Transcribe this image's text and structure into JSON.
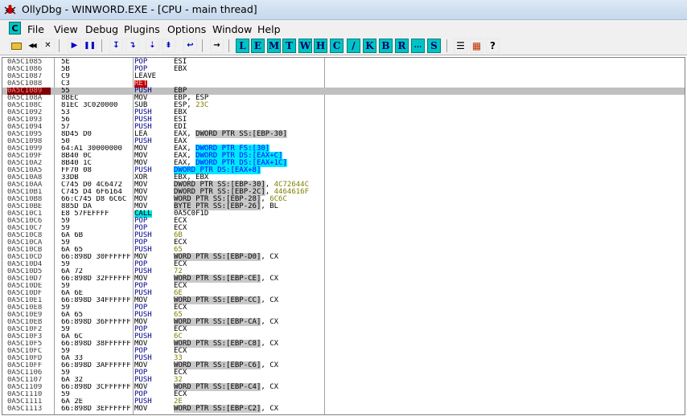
{
  "window": {
    "title": "OllyDbg - WINWORD.EXE - [CPU - main thread]"
  },
  "menu": {
    "cpu_button": "C",
    "items": [
      "File",
      "View",
      "Debug",
      "Plugins",
      "Options",
      "Window",
      "Help"
    ]
  },
  "toolbar": {
    "buttons": [
      {
        "name": "open-icon",
        "glyph": "▭"
      },
      {
        "name": "restart-icon",
        "glyph": "◀◀"
      },
      {
        "name": "close-icon",
        "glyph": "✕"
      },
      {
        "name": "run-icon",
        "glyph": "▶"
      },
      {
        "name": "pause-icon",
        "glyph": "❚❚"
      },
      {
        "name": "step-into-icon",
        "glyph": "↧"
      },
      {
        "name": "step-over-icon",
        "glyph": "↴"
      },
      {
        "name": "trace-into-icon",
        "glyph": "⇣"
      },
      {
        "name": "trace-over-icon",
        "glyph": "⇟"
      },
      {
        "name": "execute-till-return-icon",
        "glyph": "↩"
      },
      {
        "name": "go-to-icon",
        "glyph": "→"
      }
    ],
    "letters": [
      "L",
      "E",
      "M",
      "T",
      "W",
      "H",
      "C",
      "/",
      "K",
      "B",
      "R",
      "...",
      "S"
    ],
    "extra": [
      {
        "name": "list-icon",
        "glyph": "☰"
      },
      {
        "name": "grid-icon",
        "glyph": "▦"
      },
      {
        "name": "help-icon",
        "glyph": "?"
      }
    ]
  },
  "colors": {
    "jump_highlight": "#00e8ff",
    "eip_row": "#c0c0c0",
    "ret_bg": "#c00000",
    "call_bg": "#00e0e0"
  },
  "disasm": [
    {
      "addr": "0A5C1085",
      "hex": "5E",
      "mn": "POP",
      "op": "ESI"
    },
    {
      "addr": "0A5C1086",
      "hex": "5B",
      "mn": "POP",
      "op": "EBX"
    },
    {
      "addr": "0A5C1087",
      "hex": "C9",
      "mn": "LEAVE",
      "op": ""
    },
    {
      "addr": "0A5C1088",
      "hex": "C3",
      "mn": "RET",
      "op": ""
    },
    {
      "addr": "0A5C1089",
      "hex": "55",
      "mn": "PUSH",
      "op": "EBP"
    },
    {
      "addr": "0A5C108A",
      "hex": "8BEC",
      "mn": "MOV",
      "op": "EBP, ESP"
    },
    {
      "addr": "0A5C108C",
      "hex": "81EC 3C020000",
      "mn": "SUB",
      "op": "ESP, ",
      "tail": "23C"
    },
    {
      "addr": "0A5C1092",
      "hex": "53",
      "mn": "PUSH",
      "op": "EBX"
    },
    {
      "addr": "0A5C1093",
      "hex": "56",
      "mn": "PUSH",
      "op": "ESI"
    },
    {
      "addr": "0A5C1094",
      "hex": "57",
      "mn": "PUSH",
      "op": "EDI"
    },
    {
      "addr": "0A5C1095",
      "hex": "8D45 D0",
      "mn": "LEA",
      "op": "EAX, ",
      "mem": "DWORD PTR SS:[EBP-30]"
    },
    {
      "addr": "0A5C1098",
      "hex": "50",
      "mn": "PUSH",
      "op": "EAX"
    },
    {
      "addr": "0A5C1099",
      "hex": "64:A1 30000000",
      "mn": "MOV",
      "op": "EAX, ",
      "hi": "DWORD PTR FS:[30]"
    },
    {
      "addr": "0A5C109F",
      "hex": "8B40 0C",
      "mn": "MOV",
      "op": "EAX, ",
      "hi": "DWORD PTR DS:[EAX+C]"
    },
    {
      "addr": "0A5C10A2",
      "hex": "8B40 1C",
      "mn": "MOV",
      "op": "EAX, ",
      "hi": "DWORD PTR DS:[EAX+1C]"
    },
    {
      "addr": "0A5C10A5",
      "hex": "FF70 08",
      "mn": "PUSH",
      "op": "",
      "hi": "DWORD PTR DS:[EAX+8]"
    },
    {
      "addr": "0A5C10A8",
      "hex": "33DB",
      "mn": "XOR",
      "op": "EBX, EBX"
    },
    {
      "addr": "0A5C10AA",
      "hex": "C745 D0 4C6472",
      "mn": "MOV",
      "op": "",
      "mem": "DWORD PTR SS:[EBP-30]",
      "after": ", ",
      "tail": "4C72644C"
    },
    {
      "addr": "0A5C10B1",
      "hex": "C745 D4 6F6164",
      "mn": "MOV",
      "op": "",
      "mem": "DWORD PTR SS:[EBP-2C]",
      "after": ", ",
      "tail": "4464616F"
    },
    {
      "addr": "0A5C10B8",
      "hex": "66:C745 D8 6C6C",
      "mn": "MOV",
      "op": "",
      "mem": "WORD PTR SS:[EBP-28]",
      "after": ", ",
      "tail": "6C6C"
    },
    {
      "addr": "0A5C10BE",
      "hex": "885D DA",
      "mn": "MOV",
      "op": "",
      "mem": "BYTE PTR SS:[EBP-26]",
      "after": ", BL"
    },
    {
      "addr": "0A5C10C1",
      "hex": "E8 57FEFFFF",
      "mn": "CALL",
      "op": "0A5C0F1D"
    },
    {
      "addr": "0A5C10C6",
      "hex": "59",
      "mn": "POP",
      "op": "ECX"
    },
    {
      "addr": "0A5C10C7",
      "hex": "59",
      "mn": "POP",
      "op": "ECX"
    },
    {
      "addr": "0A5C10C8",
      "hex": "6A 6B",
      "mn": "PUSH",
      "op": "",
      "tail": "6B"
    },
    {
      "addr": "0A5C10CA",
      "hex": "59",
      "mn": "POP",
      "op": "ECX"
    },
    {
      "addr": "0A5C10CB",
      "hex": "6A 65",
      "mn": "PUSH",
      "op": "",
      "tail": "65"
    },
    {
      "addr": "0A5C10CD",
      "hex": "66:898D 30FFFFFF",
      "mn": "MOV",
      "op": "",
      "mem": "WORD PTR SS:[EBP-D0]",
      "after": ", CX"
    },
    {
      "addr": "0A5C10D4",
      "hex": "59",
      "mn": "POP",
      "op": "ECX"
    },
    {
      "addr": "0A5C10D5",
      "hex": "6A 72",
      "mn": "PUSH",
      "op": "",
      "tail": "72"
    },
    {
      "addr": "0A5C10D7",
      "hex": "66:898D 32FFFFFF",
      "mn": "MOV",
      "op": "",
      "mem": "WORD PTR SS:[EBP-CE]",
      "after": ", CX"
    },
    {
      "addr": "0A5C10DE",
      "hex": "59",
      "mn": "POP",
      "op": "ECX"
    },
    {
      "addr": "0A5C10DF",
      "hex": "6A 6E",
      "mn": "PUSH",
      "op": "",
      "tail": "6E"
    },
    {
      "addr": "0A5C10E1",
      "hex": "66:898D 34FFFFFF",
      "mn": "MOV",
      "op": "",
      "mem": "WORD PTR SS:[EBP-CC]",
      "after": ", CX"
    },
    {
      "addr": "0A5C10E8",
      "hex": "59",
      "mn": "POP",
      "op": "ECX"
    },
    {
      "addr": "0A5C10E9",
      "hex": "6A 65",
      "mn": "PUSH",
      "op": "",
      "tail": "65"
    },
    {
      "addr": "0A5C10EB",
      "hex": "66:898D 36FFFFFF",
      "mn": "MOV",
      "op": "",
      "mem": "WORD PTR SS:[EBP-CA]",
      "after": ", CX"
    },
    {
      "addr": "0A5C10F2",
      "hex": "59",
      "mn": "POP",
      "op": "ECX"
    },
    {
      "addr": "0A5C10F3",
      "hex": "6A 6C",
      "mn": "PUSH",
      "op": "",
      "tail": "6C"
    },
    {
      "addr": "0A5C10F5",
      "hex": "66:898D 38FFFFFF",
      "mn": "MOV",
      "op": "",
      "mem": "WORD PTR SS:[EBP-C8]",
      "after": ", CX"
    },
    {
      "addr": "0A5C10FC",
      "hex": "59",
      "mn": "POP",
      "op": "ECX"
    },
    {
      "addr": "0A5C10FD",
      "hex": "6A 33",
      "mn": "PUSH",
      "op": "",
      "tail": "33"
    },
    {
      "addr": "0A5C10FF",
      "hex": "66:898D 3AFFFFFF",
      "mn": "MOV",
      "op": "",
      "mem": "WORD PTR SS:[EBP-C6]",
      "after": ", CX"
    },
    {
      "addr": "0A5C1106",
      "hex": "59",
      "mn": "POP",
      "op": "ECX"
    },
    {
      "addr": "0A5C1107",
      "hex": "6A 32",
      "mn": "PUSH",
      "op": "",
      "tail": "32"
    },
    {
      "addr": "0A5C1109",
      "hex": "66:898D 3CFFFFFF",
      "mn": "MOV",
      "op": "",
      "mem": "WORD PTR SS:[EBP-C4]",
      "after": ", CX"
    },
    {
      "addr": "0A5C1110",
      "hex": "59",
      "mn": "POP",
      "op": "ECX"
    },
    {
      "addr": "0A5C1111",
      "hex": "6A 2E",
      "mn": "PUSH",
      "op": "",
      "tail": "2E"
    },
    {
      "addr": "0A5C1113",
      "hex": "66:898D 3EFFFFFF",
      "mn": "MOV",
      "op": "",
      "mem": "WORD PTR SS:[EBP-C2]",
      "after": ", CX"
    }
  ]
}
